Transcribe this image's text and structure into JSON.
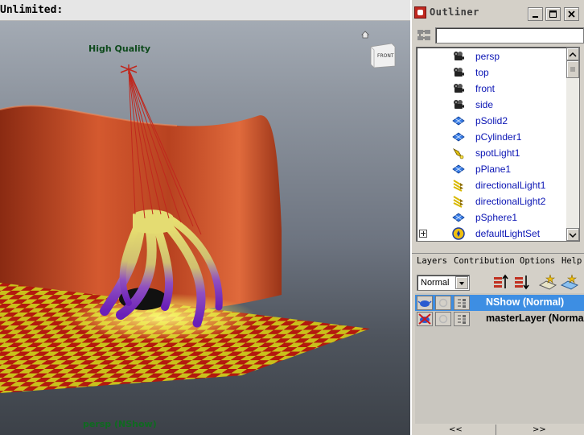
{
  "viewport": {
    "status_text": "Unlimited:",
    "hud_quality": "High Quality",
    "camera_label": "persp (NShow)",
    "view_cube_label": "FRONT"
  },
  "outliner": {
    "title": "Outliner",
    "filter_value": "",
    "items": [
      {
        "label": "persp",
        "icon": "camera-icon"
      },
      {
        "label": "top",
        "icon": "camera-icon"
      },
      {
        "label": "front",
        "icon": "camera-icon"
      },
      {
        "label": "side",
        "icon": "camera-icon"
      },
      {
        "label": "pSolid2",
        "icon": "mesh-icon"
      },
      {
        "label": "pCylinder1",
        "icon": "mesh-icon"
      },
      {
        "label": "spotLight1",
        "icon": "spot-light-icon"
      },
      {
        "label": "pPlane1",
        "icon": "mesh-icon"
      },
      {
        "label": "directionalLight1",
        "icon": "directional-light-icon"
      },
      {
        "label": "directionalLight2",
        "icon": "directional-light-icon"
      },
      {
        "label": "pSphere1",
        "icon": "mesh-icon"
      },
      {
        "label": "defaultLightSet",
        "icon": "light-set-icon"
      }
    ]
  },
  "layers": {
    "menu": [
      "Layers",
      "Contribution",
      "Options",
      "Help"
    ],
    "blend_mode": "Normal",
    "rows": [
      {
        "name": "NShow (Normal)",
        "selected": true
      },
      {
        "name": "masterLayer (Normal)",
        "selected": false
      }
    ],
    "nav_prev": "<<",
    "nav_next": ">>"
  },
  "colors": {
    "selection": "#3d8ee3",
    "outliner_text": "#0a14b4",
    "curtain": "#c4502a",
    "floor_red": "#c01810",
    "floor_yellow": "#d8d21a"
  }
}
